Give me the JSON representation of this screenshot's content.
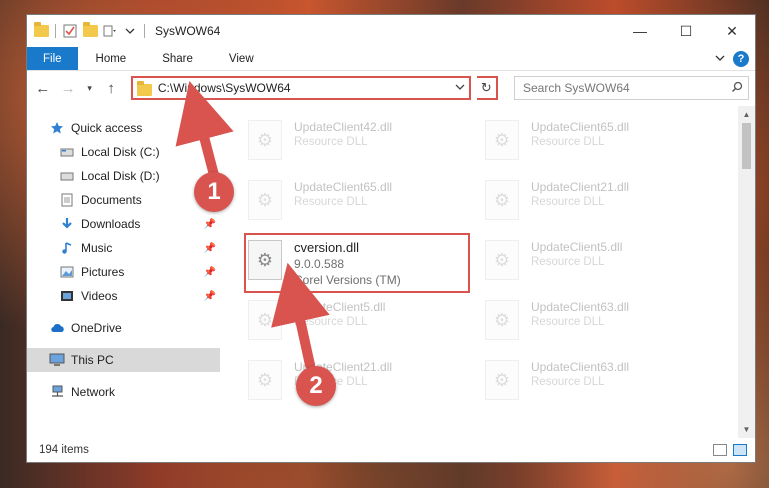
{
  "window": {
    "title": "SysWOW64",
    "controls": {
      "minimize": "—",
      "maximize": "☐",
      "close": "✕"
    }
  },
  "ribbon": {
    "tabs": [
      "File",
      "Home",
      "Share",
      "View"
    ],
    "help": "?"
  },
  "navigation": {
    "address": "C:\\Windows\\SysWOW64",
    "search_placeholder": "Search SysWOW64"
  },
  "sidebar": {
    "quick_access": "Quick access",
    "items": [
      {
        "label": "Local Disk (C:)",
        "icon": "drive-icon",
        "pinned": false
      },
      {
        "label": "Local Disk (D:)",
        "icon": "drive-icon",
        "pinned": false
      },
      {
        "label": "Documents",
        "icon": "documents-icon",
        "pinned": true
      },
      {
        "label": "Downloads",
        "icon": "downloads-icon",
        "pinned": true
      },
      {
        "label": "Music",
        "icon": "music-icon",
        "pinned": true
      },
      {
        "label": "Pictures",
        "icon": "pictures-icon",
        "pinned": true
      },
      {
        "label": "Videos",
        "icon": "videos-icon",
        "pinned": true
      }
    ],
    "onedrive": "OneDrive",
    "thispc": "This PC",
    "network": "Network"
  },
  "files": [
    {
      "name": "UpdateClient42.dll",
      "sub": "Resource DLL"
    },
    {
      "name": "UpdateClient65.dll",
      "sub": "Resource DLL"
    },
    {
      "name": "UpdateClient65.dll",
      "sub": "Resource DLL"
    },
    {
      "name": "UpdateClient21.dll",
      "sub": "Resource DLL"
    },
    {
      "name": "cversion.dll",
      "version": "9.0.0.588",
      "company": "Corel Versions (TM)"
    },
    {
      "name": "UpdateClient5.dll",
      "sub": "Resource DLL"
    },
    {
      "name": "UpdateClient5.dll",
      "sub": "Resource DLL"
    },
    {
      "name": "UpdateClient63.dll",
      "sub": "Resource DLL"
    },
    {
      "name": "UpdateClient21.dll",
      "sub": "Resource DLL"
    },
    {
      "name": "UpdateClient63.dll",
      "sub": "Resource DLL"
    }
  ],
  "status": {
    "count": "194 items"
  },
  "annotations": {
    "step1": "1",
    "step2": "2"
  },
  "colors": {
    "accent": "#1979ca",
    "highlight": "#d9534f",
    "folder": "#f3c94b"
  }
}
